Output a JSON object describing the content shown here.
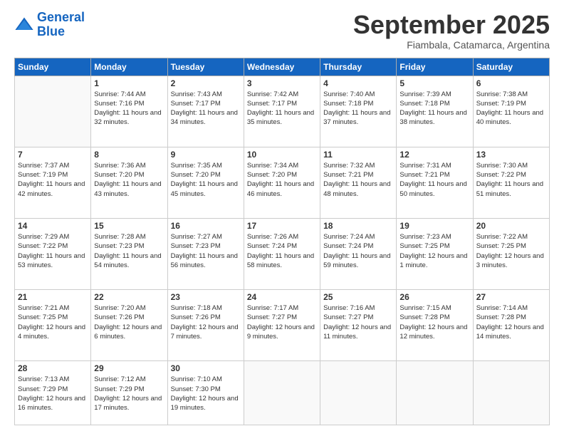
{
  "logo": {
    "line1": "General",
    "line2": "Blue"
  },
  "header": {
    "title": "September 2025",
    "subtitle": "Fiambala, Catamarca, Argentina"
  },
  "weekdays": [
    "Sunday",
    "Monday",
    "Tuesday",
    "Wednesday",
    "Thursday",
    "Friday",
    "Saturday"
  ],
  "weeks": [
    [
      null,
      {
        "num": "1",
        "sunrise": "7:44 AM",
        "sunset": "7:16 PM",
        "daylight": "11 hours and 32 minutes."
      },
      {
        "num": "2",
        "sunrise": "7:43 AM",
        "sunset": "7:17 PM",
        "daylight": "11 hours and 34 minutes."
      },
      {
        "num": "3",
        "sunrise": "7:42 AM",
        "sunset": "7:17 PM",
        "daylight": "11 hours and 35 minutes."
      },
      {
        "num": "4",
        "sunrise": "7:40 AM",
        "sunset": "7:18 PM",
        "daylight": "11 hours and 37 minutes."
      },
      {
        "num": "5",
        "sunrise": "7:39 AM",
        "sunset": "7:18 PM",
        "daylight": "11 hours and 38 minutes."
      },
      {
        "num": "6",
        "sunrise": "7:38 AM",
        "sunset": "7:19 PM",
        "daylight": "11 hours and 40 minutes."
      }
    ],
    [
      {
        "num": "7",
        "sunrise": "7:37 AM",
        "sunset": "7:19 PM",
        "daylight": "11 hours and 42 minutes."
      },
      {
        "num": "8",
        "sunrise": "7:36 AM",
        "sunset": "7:20 PM",
        "daylight": "11 hours and 43 minutes."
      },
      {
        "num": "9",
        "sunrise": "7:35 AM",
        "sunset": "7:20 PM",
        "daylight": "11 hours and 45 minutes."
      },
      {
        "num": "10",
        "sunrise": "7:34 AM",
        "sunset": "7:20 PM",
        "daylight": "11 hours and 46 minutes."
      },
      {
        "num": "11",
        "sunrise": "7:32 AM",
        "sunset": "7:21 PM",
        "daylight": "11 hours and 48 minutes."
      },
      {
        "num": "12",
        "sunrise": "7:31 AM",
        "sunset": "7:21 PM",
        "daylight": "11 hours and 50 minutes."
      },
      {
        "num": "13",
        "sunrise": "7:30 AM",
        "sunset": "7:22 PM",
        "daylight": "11 hours and 51 minutes."
      }
    ],
    [
      {
        "num": "14",
        "sunrise": "7:29 AM",
        "sunset": "7:22 PM",
        "daylight": "11 hours and 53 minutes."
      },
      {
        "num": "15",
        "sunrise": "7:28 AM",
        "sunset": "7:23 PM",
        "daylight": "11 hours and 54 minutes."
      },
      {
        "num": "16",
        "sunrise": "7:27 AM",
        "sunset": "7:23 PM",
        "daylight": "11 hours and 56 minutes."
      },
      {
        "num": "17",
        "sunrise": "7:26 AM",
        "sunset": "7:24 PM",
        "daylight": "11 hours and 58 minutes."
      },
      {
        "num": "18",
        "sunrise": "7:24 AM",
        "sunset": "7:24 PM",
        "daylight": "11 hours and 59 minutes."
      },
      {
        "num": "19",
        "sunrise": "7:23 AM",
        "sunset": "7:25 PM",
        "daylight": "12 hours and 1 minute."
      },
      {
        "num": "20",
        "sunrise": "7:22 AM",
        "sunset": "7:25 PM",
        "daylight": "12 hours and 3 minutes."
      }
    ],
    [
      {
        "num": "21",
        "sunrise": "7:21 AM",
        "sunset": "7:25 PM",
        "daylight": "12 hours and 4 minutes."
      },
      {
        "num": "22",
        "sunrise": "7:20 AM",
        "sunset": "7:26 PM",
        "daylight": "12 hours and 6 minutes."
      },
      {
        "num": "23",
        "sunrise": "7:18 AM",
        "sunset": "7:26 PM",
        "daylight": "12 hours and 7 minutes."
      },
      {
        "num": "24",
        "sunrise": "7:17 AM",
        "sunset": "7:27 PM",
        "daylight": "12 hours and 9 minutes."
      },
      {
        "num": "25",
        "sunrise": "7:16 AM",
        "sunset": "7:27 PM",
        "daylight": "12 hours and 11 minutes."
      },
      {
        "num": "26",
        "sunrise": "7:15 AM",
        "sunset": "7:28 PM",
        "daylight": "12 hours and 12 minutes."
      },
      {
        "num": "27",
        "sunrise": "7:14 AM",
        "sunset": "7:28 PM",
        "daylight": "12 hours and 14 minutes."
      }
    ],
    [
      {
        "num": "28",
        "sunrise": "7:13 AM",
        "sunset": "7:29 PM",
        "daylight": "12 hours and 16 minutes."
      },
      {
        "num": "29",
        "sunrise": "7:12 AM",
        "sunset": "7:29 PM",
        "daylight": "12 hours and 17 minutes."
      },
      {
        "num": "30",
        "sunrise": "7:10 AM",
        "sunset": "7:30 PM",
        "daylight": "12 hours and 19 minutes."
      },
      null,
      null,
      null,
      null
    ]
  ]
}
